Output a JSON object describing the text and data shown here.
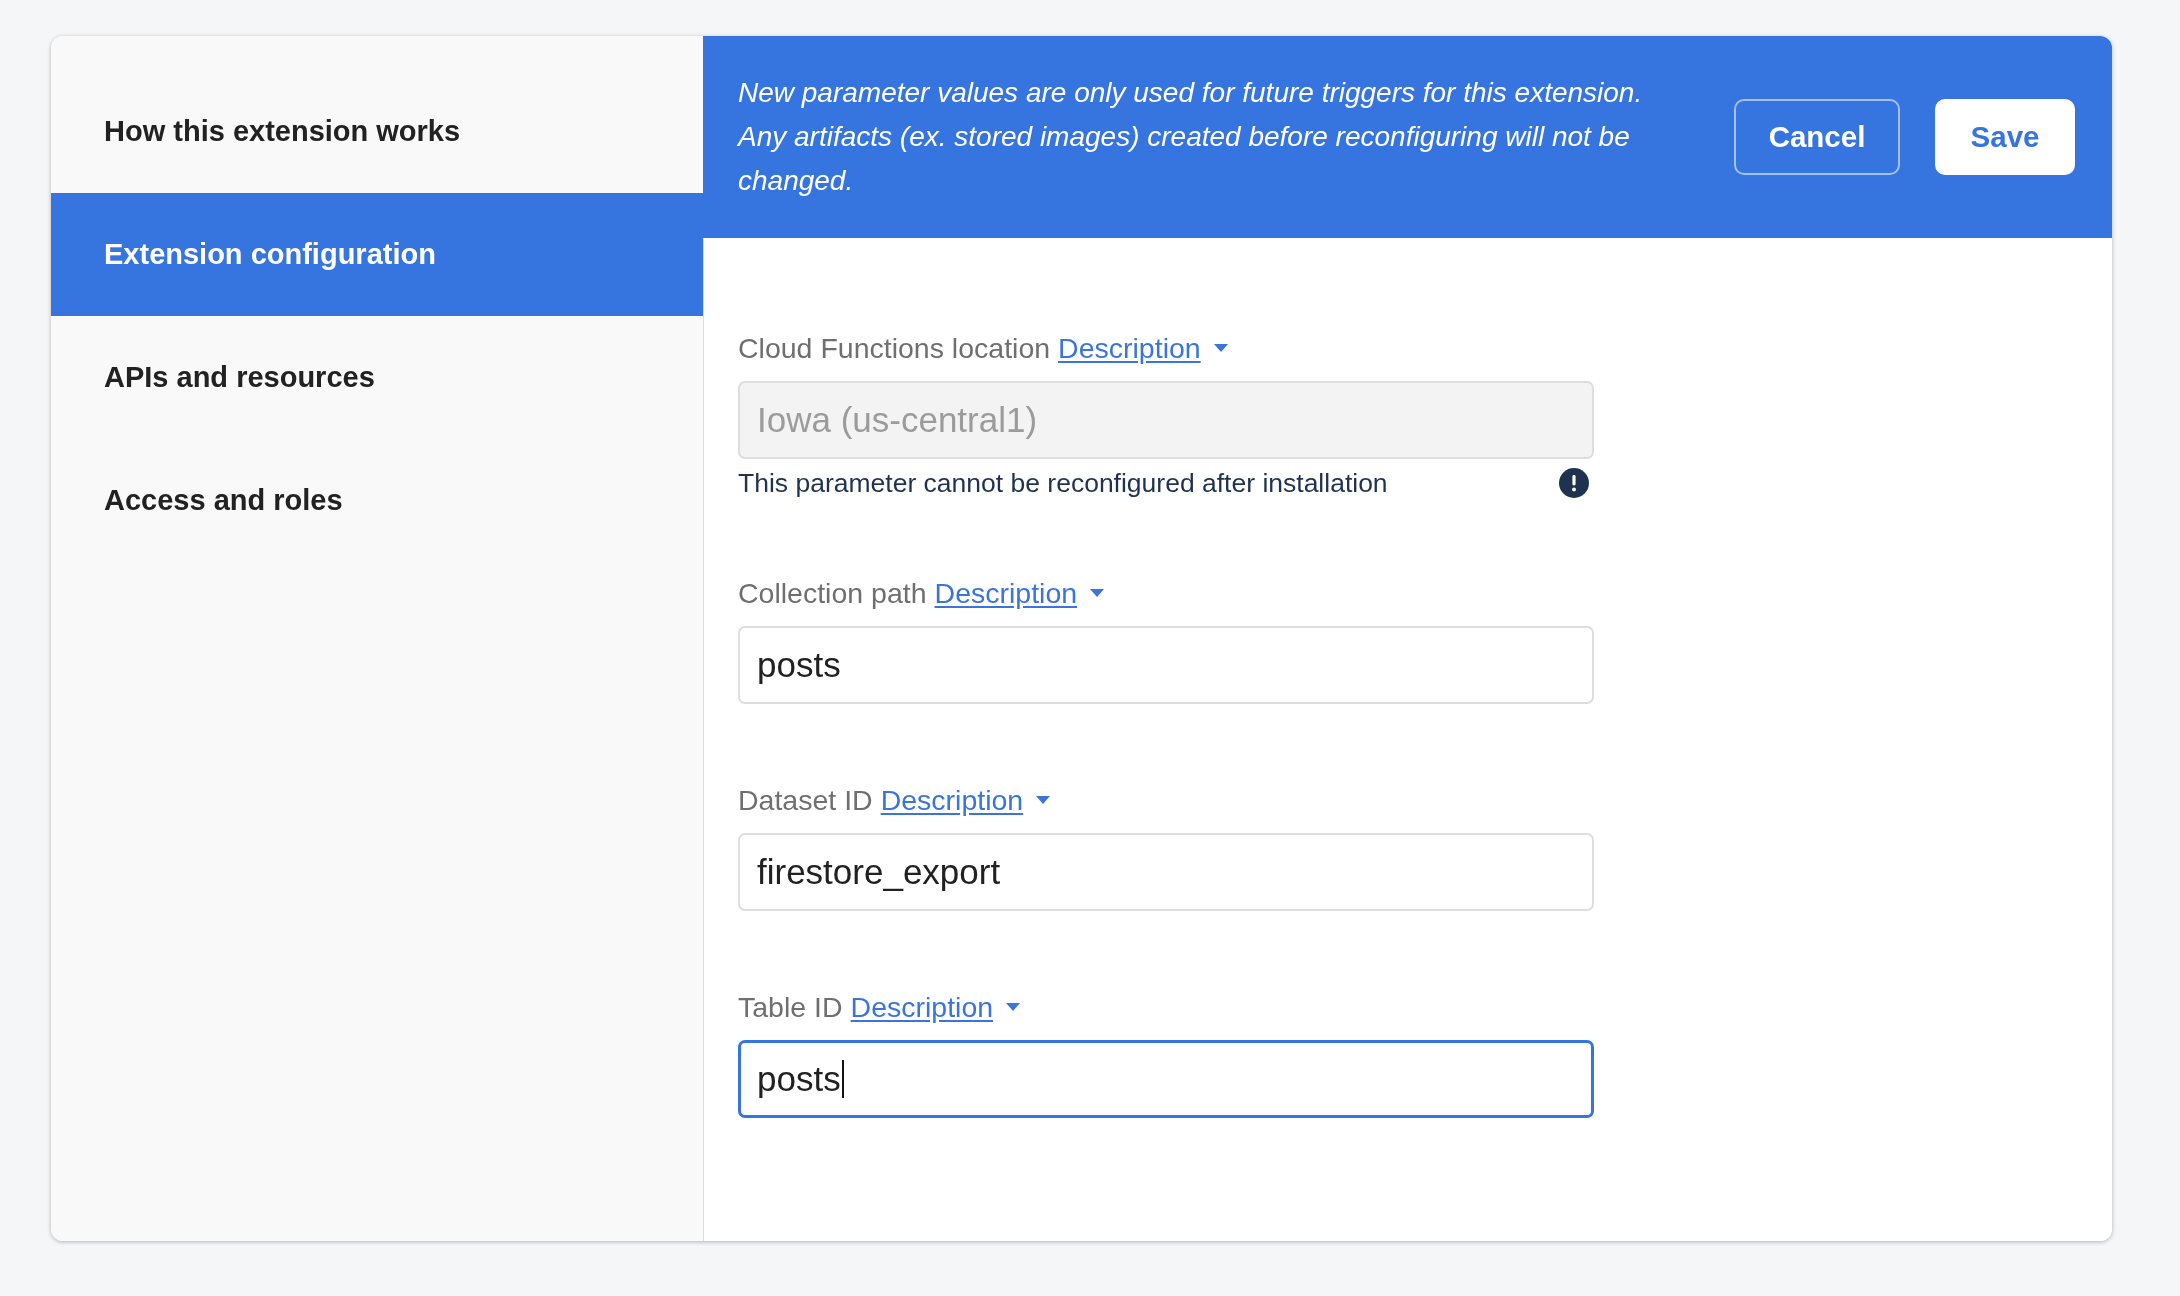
{
  "sidebar": {
    "items": [
      {
        "label": "How this extension works",
        "selected": false
      },
      {
        "label": "Extension configuration",
        "selected": true
      },
      {
        "label": "APIs and resources",
        "selected": false
      },
      {
        "label": "Access and roles",
        "selected": false
      }
    ]
  },
  "banner": {
    "message": "New parameter values are only used for future triggers for this extension. Any artifacts (ex. stored images) created before reconfiguring will not be changed.",
    "buttons": [
      {
        "label": "Cancel",
        "kind": "outlined"
      },
      {
        "label": "Save",
        "kind": "filled"
      }
    ]
  },
  "fields": [
    {
      "label": "Cloud Functions location",
      "link": "Description",
      "value": "Iowa (us-central1)",
      "disabled": true,
      "focused": false,
      "hint": "This parameter cannot be reconfigured after installation"
    },
    {
      "label": "Collection path",
      "link": "Description",
      "value": "posts",
      "disabled": false,
      "focused": false
    },
    {
      "label": "Dataset ID",
      "link": "Description",
      "value": "firestore_export",
      "disabled": false,
      "focused": false
    },
    {
      "label": "Table ID",
      "link": "Description",
      "value": "posts",
      "disabled": false,
      "focused": true
    }
  ]
}
